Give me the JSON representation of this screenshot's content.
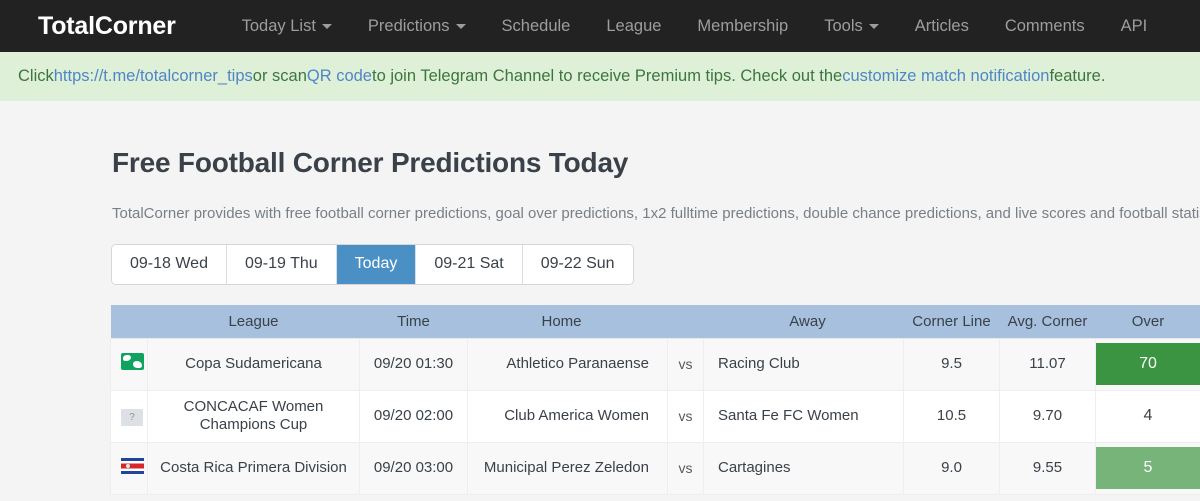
{
  "navbar": {
    "brand": "TotalCorner",
    "items": [
      {
        "label": "Today List",
        "caret": true,
        "icon": "chevron-down-icon"
      },
      {
        "label": "Predictions",
        "caret": true,
        "icon": "chevron-down-icon"
      },
      {
        "label": "Schedule",
        "caret": false
      },
      {
        "label": "League",
        "caret": false
      },
      {
        "label": "Membership",
        "caret": false
      },
      {
        "label": "Tools",
        "caret": true,
        "icon": "chevron-down-icon"
      },
      {
        "label": "Articles",
        "caret": false
      },
      {
        "label": "Comments",
        "caret": false
      },
      {
        "label": "API",
        "caret": false
      }
    ]
  },
  "alert": {
    "text_1": "Click ",
    "link_1": "https://t.me/totalcorner_tips",
    "text_2": " or scan ",
    "link_2": "QR code",
    "text_3": " to join Telegram Channel to receive Premium tips. Check out the ",
    "link_3": "customize match notification",
    "text_4": " feature."
  },
  "main": {
    "title": "Free Football Corner Predictions Today",
    "description": "TotalCorner provides with free football corner predictions, goal over predictions, 1x2 fulltime predictions, double chance predictions, and live scores and football statistics"
  },
  "date_tabs": [
    {
      "label": "09-18 Wed",
      "active": false
    },
    {
      "label": "09-19 Thu",
      "active": false
    },
    {
      "label": "Today",
      "active": true
    },
    {
      "label": "09-21 Sat",
      "active": false
    },
    {
      "label": "09-22 Sun",
      "active": false
    }
  ],
  "table": {
    "columns": [
      {
        "key": "flag",
        "label": ""
      },
      {
        "key": "league",
        "label": "League"
      },
      {
        "key": "time",
        "label": "Time"
      },
      {
        "key": "home",
        "label": "Home"
      },
      {
        "key": "vs",
        "label": ""
      },
      {
        "key": "away",
        "label": "Away"
      },
      {
        "key": "cornerline",
        "label": "Corner Line"
      },
      {
        "key": "avgcorner",
        "label": "Avg. Corner"
      },
      {
        "key": "over",
        "label": "Over"
      }
    ],
    "vs_label": "vs",
    "rows": [
      {
        "flag_icon": "globe-icon",
        "league": "Copa Sudamericana",
        "time": "09/20 01:30",
        "home": "Athletico Paranaense",
        "away": "Racing Club",
        "corner_line": "9.5",
        "avg_corner": "11.07",
        "over": "70",
        "over_style": "badge-dark-green",
        "over_color": "#3a9441"
      },
      {
        "flag_icon": "unknown-icon",
        "flag_label": "?",
        "league": "CONCACAF Women Champions Cup",
        "time": "09/20 02:00",
        "home": "Club America Women",
        "away": "Santa Fe FC Women",
        "corner_line": "10.5",
        "avg_corner": "9.70",
        "over": "4",
        "over_style": "plain",
        "over_color": "#3a4149"
      },
      {
        "flag_icon": "costa-rica-flag-icon",
        "league": "Costa Rica Primera Division",
        "time": "09/20 03:00",
        "home": "Municipal Perez Zeledon",
        "away": "Cartagines",
        "corner_line": "9.0",
        "avg_corner": "9.55",
        "over": "5",
        "over_style": "badge-light-green",
        "over_color": "#76b47a"
      }
    ]
  },
  "colors": {
    "navbar_bg": "#222222",
    "alert_bg": "#dff0d8",
    "alert_text": "#3c763d",
    "link": "#4f86c6",
    "tab_active_bg": "#4a90c4",
    "table_header_bg": "#a6c0de",
    "page_bg": "#f4f4f4"
  }
}
